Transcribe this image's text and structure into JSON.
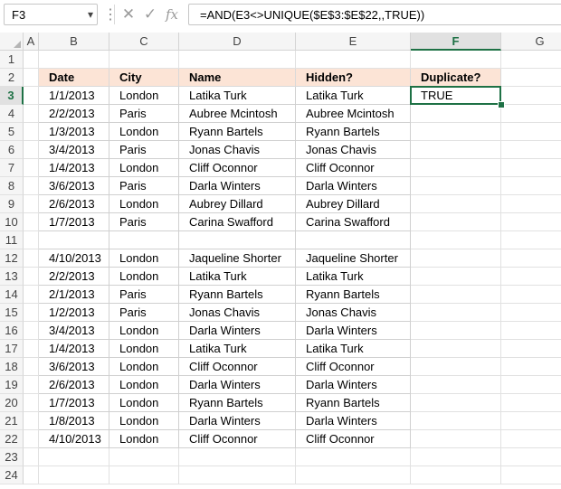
{
  "name_box": "F3",
  "formula": "=AND(E3<>UNIQUE($E$3:$E$22,,TRUE))",
  "icons": {
    "dropdown": "▾",
    "cancel": "✕",
    "enter": "✓",
    "function": "fx"
  },
  "columns": [
    "A",
    "B",
    "C",
    "D",
    "E",
    "F",
    "G"
  ],
  "headers": {
    "date": "Date",
    "city": "City",
    "name": "Name",
    "hidden": "Hidden?",
    "duplicate": "Duplicate?"
  },
  "rows": [
    {
      "row": "1"
    },
    {
      "row": "2"
    },
    {
      "row": "3",
      "date": "1/1/2013",
      "city": "London",
      "name": "Latika Turk",
      "hidden": "Latika Turk",
      "duplicate": "TRUE"
    },
    {
      "row": "4",
      "date": "2/2/2013",
      "city": "Paris",
      "name": "Aubree Mcintosh",
      "hidden": "Aubree Mcintosh"
    },
    {
      "row": "5",
      "date": "1/3/2013",
      "city": "London",
      "name": "Ryann Bartels",
      "hidden": "Ryann Bartels"
    },
    {
      "row": "6",
      "date": "3/4/2013",
      "city": "Paris",
      "name": "Jonas Chavis",
      "hidden": "Jonas Chavis"
    },
    {
      "row": "7",
      "date": "1/4/2013",
      "city": "London",
      "name": "Cliff Oconnor",
      "hidden": "Cliff Oconnor"
    },
    {
      "row": "8",
      "date": "3/6/2013",
      "city": "Paris",
      "name": "Darla Winters",
      "hidden": "Darla Winters"
    },
    {
      "row": "9",
      "date": "2/6/2013",
      "city": "London",
      "name": "Aubrey Dillard",
      "hidden": "Aubrey Dillard"
    },
    {
      "row": "10",
      "date": "1/7/2013",
      "city": "Paris",
      "name": "Carina Swafford",
      "hidden": "Carina Swafford"
    },
    {
      "row": "11",
      "date": "",
      "city": "",
      "name": "",
      "hidden": ""
    },
    {
      "row": "12",
      "date": "4/10/2013",
      "city": "London",
      "name": "Jaqueline Shorter",
      "hidden": "Jaqueline Shorter"
    },
    {
      "row": "13",
      "date": "2/2/2013",
      "city": "London",
      "name": "Latika Turk",
      "hidden": "Latika Turk"
    },
    {
      "row": "14",
      "date": "2/1/2013",
      "city": "Paris",
      "name": "Ryann Bartels",
      "hidden": "Ryann Bartels"
    },
    {
      "row": "15",
      "date": "1/2/2013",
      "city": "Paris",
      "name": "Jonas Chavis",
      "hidden": "Jonas Chavis"
    },
    {
      "row": "16",
      "date": "3/4/2013",
      "city": "London",
      "name": "Darla Winters",
      "hidden": "Darla Winters"
    },
    {
      "row": "17",
      "date": "1/4/2013",
      "city": "London",
      "name": "Latika Turk",
      "hidden": "Latika Turk"
    },
    {
      "row": "18",
      "date": "3/6/2013",
      "city": "London",
      "name": "Cliff Oconnor",
      "hidden": "Cliff Oconnor"
    },
    {
      "row": "19",
      "date": "2/6/2013",
      "city": "London",
      "name": "Darla Winters",
      "hidden": "Darla Winters"
    },
    {
      "row": "20",
      "date": "1/7/2013",
      "city": "London",
      "name": "Ryann Bartels",
      "hidden": "Ryann Bartels"
    },
    {
      "row": "21",
      "date": "1/8/2013",
      "city": "London",
      "name": "Darla Winters",
      "hidden": "Darla Winters"
    },
    {
      "row": "22",
      "date": "4/10/2013",
      "city": "London",
      "name": "Cliff Oconnor",
      "hidden": "Cliff Oconnor"
    },
    {
      "row": "23"
    },
    {
      "row": "24"
    }
  ],
  "selected_cell": "F3",
  "colors": {
    "header_fill": "#fce4d6",
    "selection": "#1e7145"
  }
}
